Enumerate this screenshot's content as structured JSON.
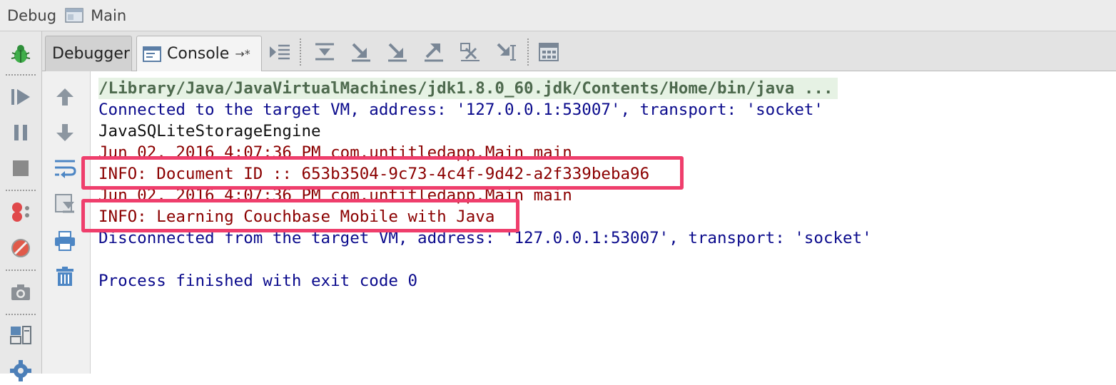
{
  "window": {
    "title_prefix": "Debug",
    "title_config": "Main"
  },
  "tabs": {
    "debugger_label": "Debugger",
    "console_label": "Console",
    "console_pin": "→*"
  },
  "left_toolbar": [
    "bug-icon",
    "resume-icon",
    "pause-icon",
    "stop-icon",
    "breakpoints-icon",
    "mute-breakpoints-icon",
    "snapshot-icon",
    "layout-icon",
    "settings-icon"
  ],
  "console_toolbar": [
    "show-execution-point-icon",
    "step-over-icon",
    "step-into-icon",
    "force-step-into-icon",
    "step-out-icon",
    "drop-frame-icon",
    "run-to-cursor-icon",
    "evaluate-icon"
  ],
  "console_side_toolbar": [
    "up-icon",
    "down-icon",
    "soft-wrap-icon",
    "scroll-to-end-icon",
    "print-icon",
    "clear-icon"
  ],
  "console": {
    "lines": [
      "/Library/Java/JavaVirtualMachines/jdk1.8.0_60.jdk/Contents/Home/bin/java ...",
      "Connected to the target VM, address: '127.0.0.1:53007', transport: 'socket'",
      "JavaSQLiteStorageEngine",
      "Jun 02, 2016 4:07:36 PM com.untitledapp.Main main",
      "INFO: Document ID :: 653b3504-9c73-4c4f-9d42-a2f339beba96",
      "Jun 02, 2016 4:07:36 PM com.untitledapp.Main main",
      "INFO: Learning Couchbase Mobile with Java",
      "Disconnected from the target VM, address: '127.0.0.1:53007', transport: 'socket'",
      "",
      "Process finished with exit code 0"
    ]
  },
  "colors": {
    "command": "#4e6a4e",
    "system": "#0a0a8c",
    "stdout": "#111111",
    "stderr": "#8b0000",
    "highlight": "#ef3e6c"
  }
}
